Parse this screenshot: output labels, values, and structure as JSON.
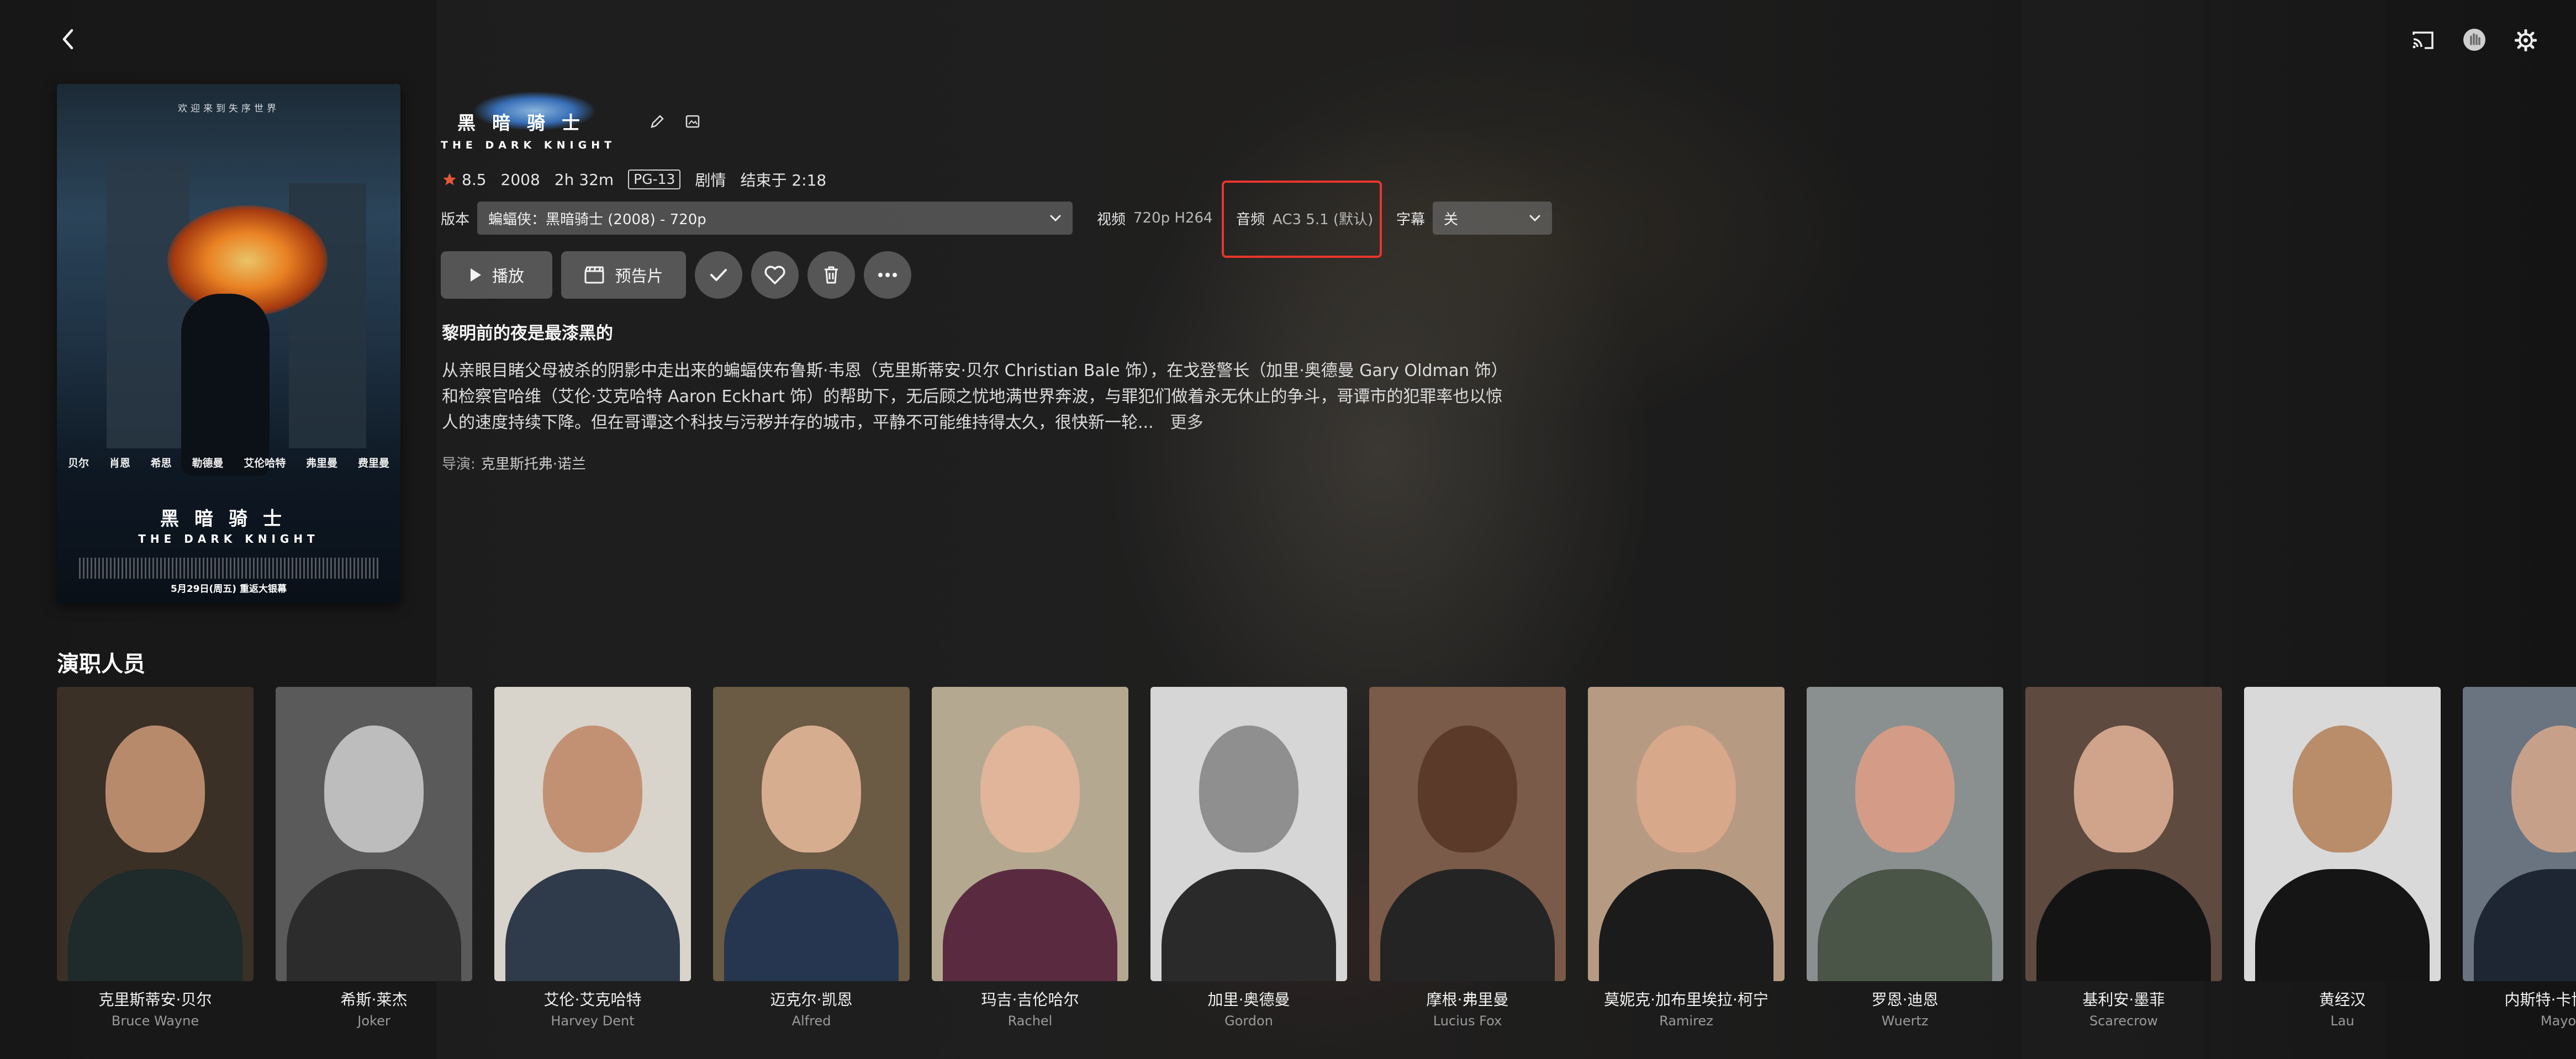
{
  "top_bar": {
    "back_icon": "chevron-left-icon",
    "right_icons": [
      "cast-icon",
      "hand-icon",
      "gear-icon"
    ]
  },
  "poster": {
    "tagline": "欢迎来到失序世界",
    "names": [
      "贝尔",
      "肖恩",
      "希思",
      "勒德曼",
      "艾伦哈特",
      "弗里曼",
      "费里曼"
    ],
    "logo_cn": "黑暗骑士",
    "logo_en": "THE DARK KNIGHT",
    "release": "5月29日(周五) 重返大银幕"
  },
  "title": {
    "logo_cn": "黑暗骑士",
    "logo_en": "THE DARK KNIGHT",
    "edit_icon": "pencil-icon",
    "image_icon": "image-icon"
  },
  "meta": {
    "rating": "8.5",
    "year": "2008",
    "runtime": "2h 32m",
    "certification": "PG-13",
    "genre": "剧情",
    "ends_at": "结束于 2:18"
  },
  "media": {
    "version_label": "版本",
    "version_value": "蝙蝠侠：黑暗骑士 (2008) - 720p",
    "video_label": "视频",
    "video_value": "720p H264",
    "audio_label": "音频",
    "audio_value": "AC3 5.1 (默认)",
    "subtitle_label": "字幕",
    "subtitle_value": "关"
  },
  "actions": {
    "play_label": "播放",
    "trailer_label": "预告片"
  },
  "tagline": "黎明前的夜是最漆黑的",
  "overview": "从亲眼目睹父母被杀的阴影中走出来的蝙蝠侠布鲁斯·韦恩（克里斯蒂安·贝尔 Christian Bale 饰），在戈登警长（加里·奥德曼 Gary Oldman 饰）和检察官哈维（艾伦·艾克哈特 Aaron Eckhart 饰）的帮助下，无后顾之忧地满世界奔波，与罪犯们做着永无休止的争斗，哥谭市的犯罪率也以惊人的速度持续下降。但在哥谭这个科技与污秽并存的城市，平静不可能维持得太久，很快新一轮...",
  "more_label": "更多",
  "director": {
    "label": "导演:",
    "name": "克里斯托弗·诺兰"
  },
  "cast_title": "演职人员",
  "cast": [
    {
      "name": "克里斯蒂安·贝尔",
      "role": "Bruce Wayne",
      "bg": "#3a3026",
      "skin": "#b88a6c",
      "shirt": "#1f2a2a"
    },
    {
      "name": "希斯·莱杰",
      "role": "Joker",
      "bg": "#5a5a5a",
      "skin": "#bdbdbd",
      "shirt": "#2c2c2c"
    },
    {
      "name": "艾伦·艾克哈特",
      "role": "Harvey Dent",
      "bg": "#d8d3cb",
      "skin": "#c29174",
      "shirt": "#2f3b4a"
    },
    {
      "name": "迈克尔·凯恩",
      "role": "Alfred",
      "bg": "#6b5a44",
      "skin": "#d7ad8f",
      "shirt": "#273650"
    },
    {
      "name": "玛吉·吉伦哈尔",
      "role": "Rachel",
      "bg": "#b5a890",
      "skin": "#e0b59a",
      "shirt": "#5a2b40"
    },
    {
      "name": "加里·奥德曼",
      "role": "Gordon",
      "bg": "#d6d6d6",
      "skin": "#8f8f8f",
      "shirt": "#2a2a2a"
    },
    {
      "name": "摩根·弗里曼",
      "role": "Lucius Fox",
      "bg": "#7a5a48",
      "skin": "#5b3a2a",
      "shirt": "#242424"
    },
    {
      "name": "莫妮克·加布里埃拉·柯宁",
      "role": "Ramirez",
      "bg": "#b79a82",
      "skin": "#d8a88a",
      "shirt": "#1b1b1b"
    },
    {
      "name": "罗恩·迪恩",
      "role": "Wuertz",
      "bg": "#8a8f90",
      "skin": "#d49c86",
      "shirt": "#4a5548"
    },
    {
      "name": "基利安·墨菲",
      "role": "Scarecrow",
      "bg": "#5e4a3e",
      "skin": "#cfa48a",
      "shirt": "#141414"
    },
    {
      "name": "黄经汉",
      "role": "Lau",
      "bg": "#d9d9d9",
      "skin": "#b98c6a",
      "shirt": "#151515"
    },
    {
      "name": "内斯特·卡博内尔",
      "role": "Mayor",
      "bg": "#6a7380",
      "skin": "#c7a08a",
      "shirt": "#1e2533"
    }
  ],
  "colors": {
    "accent_highlight": "#e8362b",
    "star": "#e8563a"
  }
}
